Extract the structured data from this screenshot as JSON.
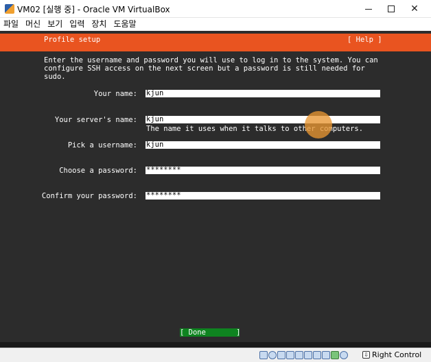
{
  "window": {
    "title": "VM02 [실행 중] - Oracle VM VirtualBox",
    "icons": {
      "app": "virtualbox-icon",
      "minimize": "minimize-icon",
      "maximize": "maximize-icon",
      "close": "close-icon"
    },
    "close_glyph": "✕"
  },
  "menu": {
    "items": [
      "파일",
      "머신",
      "보기",
      "입력",
      "장치",
      "도움말"
    ]
  },
  "installer": {
    "header_title": "Profile setup",
    "help_label": "[ Help ]",
    "intro_text": "Enter the username and password you will use to log in to the system. You can\nconfigure SSH access on the next screen but a password is still needed for\nsudo.",
    "fields": {
      "your_name": {
        "label": "Your name:",
        "value": "kjun"
      },
      "server_name": {
        "label": "Your server's name:",
        "value": "kjun",
        "hint": "The name it uses when it talks to other computers."
      },
      "username": {
        "label": "Pick a username:",
        "value": "kjun"
      },
      "password": {
        "label": "Choose a password:",
        "value": "********"
      },
      "confirm_password": {
        "label": "Confirm your password:",
        "value": "********"
      }
    },
    "done_label": "[ Done       ]",
    "colors": {
      "header": "#e95420",
      "background": "#2c2c2c",
      "done": "#0e8420"
    }
  },
  "statusbar": {
    "host_key": "Right Control",
    "icons": [
      "hard-disk-icon",
      "optical-drive-icon",
      "audio-icon",
      "network-icon",
      "usb-icon",
      "shared-folder-icon",
      "display-icon",
      "recording-icon",
      "cpu-icon",
      "mouse-integration-icon",
      "keyboard-icon"
    ]
  }
}
